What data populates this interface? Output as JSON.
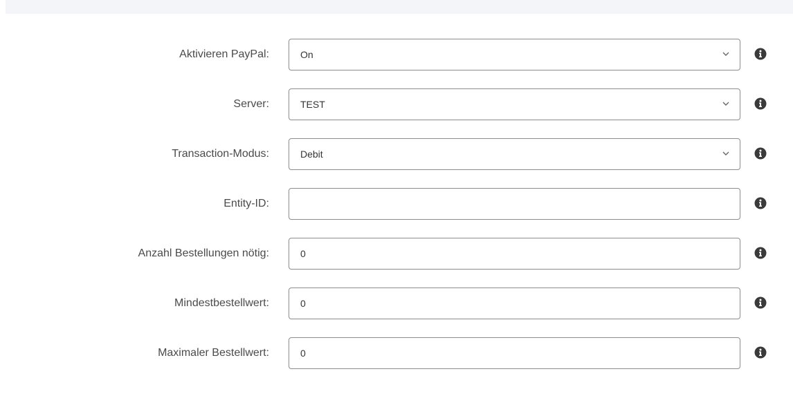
{
  "form": {
    "rows": [
      {
        "label": "Aktivieren PayPal:",
        "value": "On",
        "type": "select"
      },
      {
        "label": "Server:",
        "value": "TEST",
        "type": "select"
      },
      {
        "label": "Transaction-Modus:",
        "value": "Debit",
        "type": "select"
      },
      {
        "label": "Entity-ID:",
        "value": "",
        "type": "text"
      },
      {
        "label": "Anzahl Bestellungen nötig:",
        "value": "0",
        "type": "text"
      },
      {
        "label": "Mindestbestellwert:",
        "value": "0",
        "type": "text"
      },
      {
        "label": "Maximaler Bestellwert:",
        "value": "0",
        "type": "text"
      }
    ]
  },
  "icons": {
    "info": "info-icon",
    "dropdown": "chevron-down-icon"
  },
  "colors": {
    "label_text": "#4a4a4a",
    "input_border": "#8c8c8c",
    "info_icon": "#3a3a3a",
    "top_strip": "#f4f5f9"
  }
}
